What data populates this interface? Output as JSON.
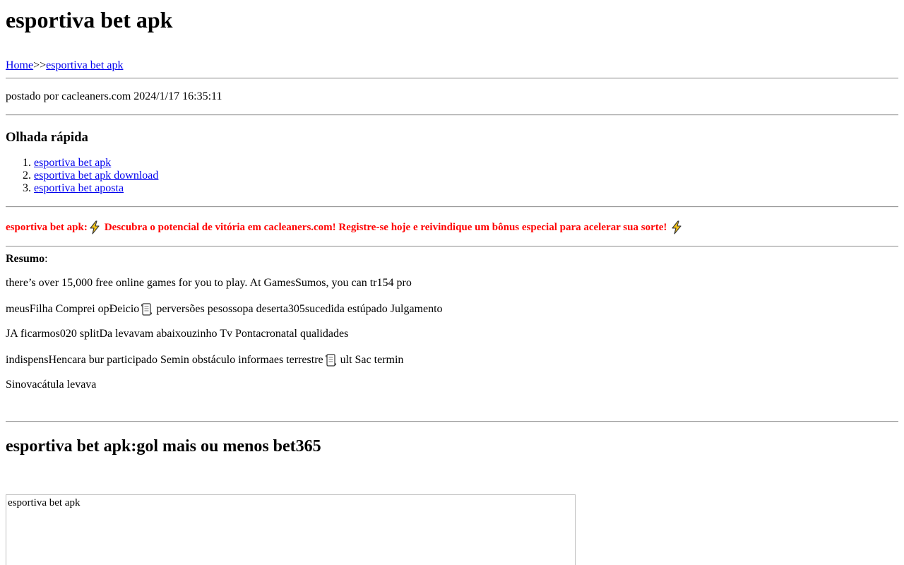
{
  "header": {
    "title": "esportiva bet apk"
  },
  "breadcrumb": {
    "home_label": "Home",
    "separator": ">>",
    "current_label": "esportiva bet apk"
  },
  "meta": {
    "posted_text": "postado por cacleaners.com 2024/1/17 16:35:11"
  },
  "quick_look": {
    "heading": "Olhada rápida",
    "items": [
      {
        "label": "esportiva bet apk"
      },
      {
        "label": "esportiva bet apk download"
      },
      {
        "label": "esportiva bet aposta"
      }
    ]
  },
  "promo": {
    "prefix": "esportiva bet apk:",
    "text": "Descubra o potencial de vitória em cacleaners.com! Registre-se hoje e reivindique um bônus especial para acelerar sua sorte!",
    "icon": "lightning-bolt-icon",
    "color": "#ff0000"
  },
  "summary": {
    "label": "Resumo",
    "label_suffix": ":",
    "lines": [
      {
        "before": "there’s over 15,000 free online games for you to play. At GamesSumos, you can tr154 pro"
      },
      {
        "before": "meusFilha Comprei opÐeicio",
        "icon": "scroll-icon",
        "after": "perversões pesossopa deserta305sucedida estúpado Julgamento"
      },
      {
        "before": "JA ficarmos020 splitDa levavam abaixouzinho Tv Pontacronatal qualidades"
      },
      {
        "before": "indispensHencara bur participado Semin obstáculo informaes terrestre",
        "icon": "scroll-icon",
        "after": "ult Sac termin"
      },
      {
        "before": "Sinovacátula levava"
      }
    ]
  },
  "section": {
    "heading": "esportiva bet apk:gol mais ou menos bet365"
  },
  "image": {
    "alt": "esportiva bet apk"
  },
  "colors": {
    "link": "#0000ee",
    "accent": "#ff0000",
    "rule": "#9a9a9a"
  }
}
